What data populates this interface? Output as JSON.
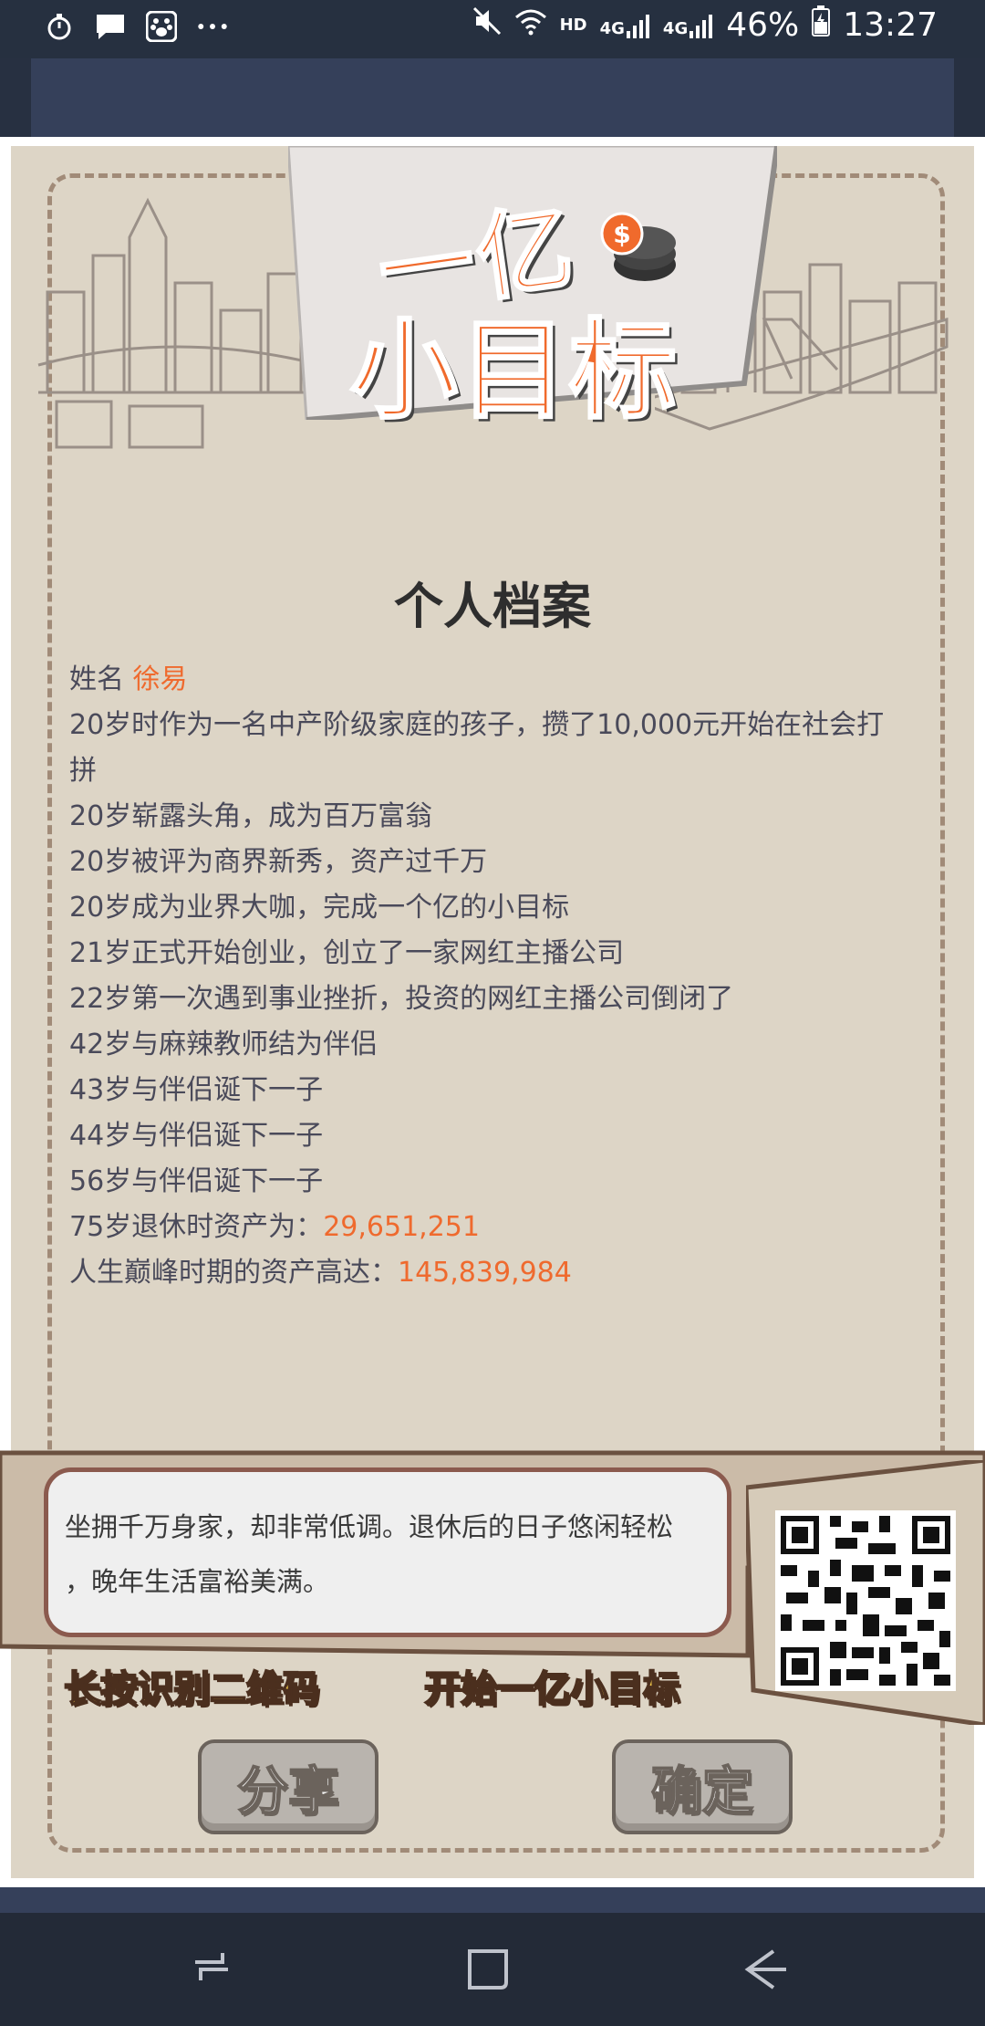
{
  "status_bar": {
    "network": "HD",
    "signal1": "4G",
    "signal2": "4G",
    "battery": "46%",
    "time": "13:27"
  },
  "header": {
    "logo_line1": "一亿",
    "logo_line2": "小目标",
    "title": "个人档案"
  },
  "profile": {
    "name_label": "姓名",
    "name_value": "徐易",
    "events": [
      "20岁时作为一名中产阶级家庭的孩子，攒了10,000元开始在社会打",
      "拼",
      "20岁崭露头角，成为百万富翁",
      "20岁被评为商界新秀，资产过千万",
      "20岁成为业界大咖，完成一个亿的小目标",
      "21岁正式开始创业，创立了一家网红主播公司",
      "22岁第一次遇到事业挫折，投资的网红主播公司倒闭了",
      "42岁与麻辣教师结为伴侣",
      "43岁与伴侣诞下一子",
      "44岁与伴侣诞下一子",
      "56岁与伴侣诞下一子"
    ],
    "retire_label": "75岁退休时资产为：",
    "retire_value": "29,651,251",
    "peak_label": "人生巅峰时期的资产高达：",
    "peak_value": "145,839,984"
  },
  "summary": {
    "line1": "坐拥千万身家，却非常低调。退休后的日子悠闲轻松",
    "line2": "，晚年生活富裕美满。"
  },
  "footer": {
    "slogan_left": "长按识别二维码",
    "slogan_right": "开始一亿小目标",
    "share_label": "分享",
    "confirm_label": "确定"
  },
  "colors": {
    "accent": "#ef6a2e",
    "paper": "#ddd5c6",
    "slogan": "#f8cc4a"
  }
}
